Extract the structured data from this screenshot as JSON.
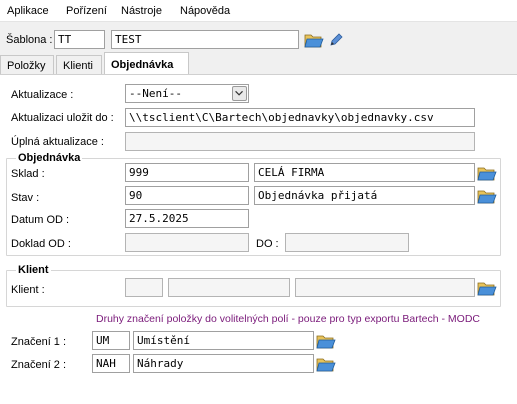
{
  "menu": [
    "Aplikace",
    "Pořízení",
    "Nástroje",
    "Nápověda"
  ],
  "template": {
    "label": "Šablona :",
    "code": "TT",
    "name": "TEST",
    "open_icon": "folder-open-icon",
    "edit_icon": "pencil-icon"
  },
  "tabs": [
    "Položky",
    "Klienti",
    "Objednávka"
  ],
  "active_tab": "Objednávka",
  "form": {
    "update_label": "Aktualizace :",
    "update_value": "--Není--",
    "save_to_label": "Aktualizaci uložit do :",
    "save_to_value": "\\\\tsclient\\C\\Bartech\\objednavky\\objednavky.csv",
    "full_update_label": "Úplná aktualizace :",
    "full_update_value": ""
  },
  "order": {
    "title": "Objednávka",
    "warehouse_label": "Sklad :",
    "warehouse_code": "999",
    "warehouse_name": "CELÁ FIRMA",
    "status_label": "Stav :",
    "status_code": "90",
    "status_name": "Objednávka přijatá",
    "date_from_label": "Datum OD :",
    "date_from_value": "27.5.2025",
    "doc_from_label": "Doklad OD :",
    "doc_from_value": "",
    "to_label": "DO :",
    "to_value": ""
  },
  "client": {
    "title": "Klient",
    "label": "Klient :",
    "f1": "",
    "f2": "",
    "f3": ""
  },
  "marks": {
    "note": "Druhy značení položky do volitelných polí - pouze pro typ exportu Bartech - MODC",
    "m1_label": "Značení 1 :",
    "m1_code": "UM",
    "m1_name": "Umístění",
    "m2_label": "Značení 2 :",
    "m2_code": "NAH",
    "m2_name": "Náhrady"
  },
  "colors": {
    "note": "#7a1a7a",
    "folder": "#2f7fc9"
  }
}
